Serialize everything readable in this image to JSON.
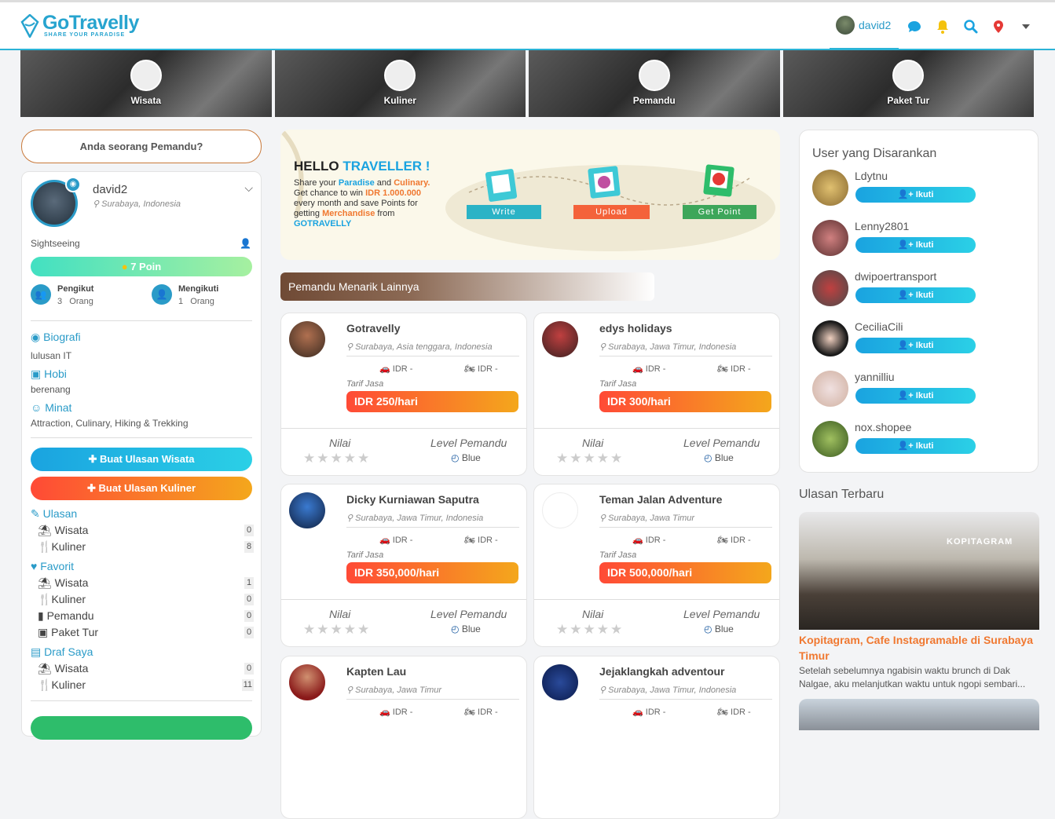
{
  "brand": {
    "name": "GoTravelly",
    "tagline": "SHARE YOUR PARADISE"
  },
  "topnav": {
    "username": "david2",
    "icons": [
      "chat-icon",
      "bell-icon",
      "search-icon",
      "location-icon",
      "caret-down-icon"
    ],
    "colors": {
      "chat": "#1aa3e0",
      "bell": "#f4c20d",
      "search": "#1aa3e0",
      "location": "#e53935"
    }
  },
  "categories": [
    {
      "label": "Wisata",
      "icon": "palm-tree-icon"
    },
    {
      "label": "Kuliner",
      "icon": "plate-icon"
    },
    {
      "label": "Pemandu",
      "icon": "compass-icon"
    },
    {
      "label": "Paket Tur",
      "icon": "passport-icon"
    }
  ],
  "sidebar": {
    "guide_question": "Anda seorang Pemandu?",
    "profile": {
      "name": "david2",
      "location": "Surabaya, Indonesia",
      "type": "Sightseeing",
      "points": "7 Poin"
    },
    "followers": {
      "label": "Pengikut",
      "count": "3",
      "unit": "Orang"
    },
    "following": {
      "label": "Mengikuti",
      "count": "1",
      "unit": "Orang"
    },
    "bio": {
      "title": "Biografi",
      "text": "lulusan IT"
    },
    "hobby": {
      "title": "Hobi",
      "text": "berenang"
    },
    "interest": {
      "title": "Minat",
      "text": "Attraction, Culinary, Hiking & Trekking"
    },
    "btn_wisata": "Buat Ulasan Wisata",
    "btn_kuliner": "Buat Ulasan Kuliner",
    "ulasan": {
      "title": "Ulasan",
      "items": [
        {
          "label": "Wisata",
          "count": "0"
        },
        {
          "label": "Kuliner",
          "count": "8"
        }
      ]
    },
    "favorit": {
      "title": "Favorit",
      "items": [
        {
          "label": "Wisata",
          "count": "1"
        },
        {
          "label": "Kuliner",
          "count": "0"
        },
        {
          "label": "Pemandu",
          "count": "0"
        },
        {
          "label": "Paket Tur",
          "count": "0"
        }
      ]
    },
    "draf": {
      "title": "Draf Saya",
      "items": [
        {
          "label": "Wisata",
          "count": "0"
        },
        {
          "label": "Kuliner",
          "count": "11"
        }
      ]
    }
  },
  "banner": {
    "title1": "HELLO",
    "title2": "TRAVELLER !",
    "l1a": "Share your ",
    "l1b": "Paradise",
    "l1c": " and ",
    "l1d": "Culinary.",
    "l2a": "Get chance to win ",
    "l2b": "IDR 1.000.000",
    "l3": "every month and save Points for",
    "l4a": "getting ",
    "l4b": "Merchandise",
    "l4c": " from",
    "l5": "GOTRAVELLY",
    "step1": "Write",
    "step2": "Upload",
    "step3": "Get Point"
  },
  "guides_section": "Pemandu Menarik Lainnya",
  "guides": [
    {
      "name": "Gotravelly",
      "location": "Surabaya, Asia tenggara, Indonesia",
      "car": "IDR -",
      "moto": "IDR -",
      "tarif_label": "Tarif Jasa",
      "rate": "IDR 250/hari",
      "nilai": "Nilai",
      "level_label": "Level Pemandu",
      "level": "Blue"
    },
    {
      "name": "edys holidays",
      "location": "Surabaya, Jawa Timur, Indonesia",
      "car": "IDR -",
      "moto": "IDR -",
      "tarif_label": "Tarif Jasa",
      "rate": "IDR 300/hari",
      "nilai": "Nilai",
      "level_label": "Level Pemandu",
      "level": "Blue"
    },
    {
      "name": "Dicky Kurniawan Saputra",
      "location": "Surabaya, Jawa Timur, Indonesia",
      "car": "IDR -",
      "moto": "IDR -",
      "tarif_label": "Tarif Jasa",
      "rate": "IDR 350,000/hari",
      "nilai": "Nilai",
      "level_label": "Level Pemandu",
      "level": "Blue"
    },
    {
      "name": "Teman Jalan Adventure",
      "location": "Surabaya, Jawa Timur",
      "car": "IDR -",
      "moto": "IDR -",
      "tarif_label": "Tarif Jasa",
      "rate": "IDR 500,000/hari",
      "nilai": "Nilai",
      "level_label": "Level Pemandu",
      "level": "Blue"
    },
    {
      "name": "Kapten Lau",
      "location": "Surabaya, Jawa Timur",
      "car": "IDR -",
      "moto": "IDR -"
    },
    {
      "name": "Jejaklangkah adventour",
      "location": "Surabaya, Jawa Timur, Indonesia",
      "car": "IDR -",
      "moto": "IDR -"
    }
  ],
  "suggested": {
    "title": "User yang Disarankan",
    "follow_label": "Ikuti",
    "users": [
      {
        "name": "Ldytnu"
      },
      {
        "name": "Lenny2801"
      },
      {
        "name": "dwipoertransport"
      },
      {
        "name": "CeciliaCili"
      },
      {
        "name": "yannilliu"
      },
      {
        "name": "nox.shopee"
      }
    ]
  },
  "latest_review": {
    "title": "Ulasan Terbaru",
    "sign": "KOPITAGRAM",
    "item_title": "Kopitagram, Cafe Instagramable di Surabaya Timur",
    "item_desc": "Setelah sebelumnya ngabisin waktu brunch di Dak Nalgae, aku melanjutkan waktu untuk ngopi sembari..."
  }
}
